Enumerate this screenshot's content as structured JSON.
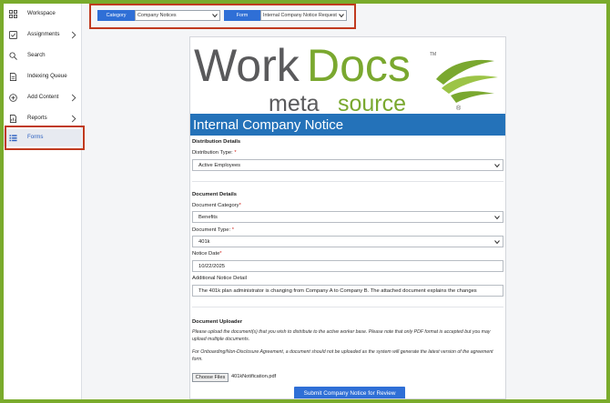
{
  "sidebar": {
    "items": [
      {
        "label": "Workspace",
        "icon": "grid-icon"
      },
      {
        "label": "Assignments",
        "icon": "checkbox-icon",
        "chevron": true
      },
      {
        "label": "Search",
        "icon": "search-icon"
      },
      {
        "label": "Indexing Queue",
        "icon": "document-icon"
      },
      {
        "label": "Add Content",
        "icon": "plus-circle-icon",
        "chevron": true
      },
      {
        "label": "Reports",
        "icon": "report-icon",
        "chevron": true
      },
      {
        "label": "Forms",
        "icon": "list-icon",
        "active": true
      }
    ]
  },
  "toolbar": {
    "category_label": "Category",
    "category_value": "Company Notices",
    "form_label": "Form",
    "form_value": "Internal Company Notice Request"
  },
  "logo": {
    "brand_dark": "Work",
    "brand_green": "Docs",
    "trademark": "TM",
    "sub_dark": "meta",
    "sub_green": "source",
    "registered": "®"
  },
  "form": {
    "title": "Internal Company Notice",
    "distribution_heading": "Distribution Details",
    "distribution_type_label": "Distribution Type:",
    "distribution_type_value": "Active Employees",
    "document_heading": "Document Details",
    "document_category_label": "Document Category",
    "document_category_value": "Benefits",
    "document_type_label": "Document Type:",
    "document_type_value": "401k",
    "notice_date_label": "Notice Date",
    "notice_date_value": "10/22/2025",
    "notice_detail_label": "Additional Notice Detail",
    "notice_detail_value": "The 401k plan administrator is changing from Company A to Company B. The attached document explains the changes",
    "required_mark": "*",
    "uploader_heading": "Document Uploader",
    "uploader_note_1": "Please upload the document(s) that you wish to distribute to the active worker base.  Please note that only PDF format is accepted but you may upload multiple documents.",
    "uploader_note_2": "For Onboarding/Non-Disclosure Agreement, a document should not be uploaded as the system will generate the latest version of the agreement form.",
    "choose_files_label": "Choose Files",
    "file_name": "401kNotification.pdf",
    "submit_label": "Submit Company Notice for Review"
  },
  "colors": {
    "accent": "#2f6fd6",
    "banner": "#2472b9",
    "highlight": "#c03a1f",
    "brand_green": "#7aa82f",
    "border_green": "#7aab2c"
  }
}
